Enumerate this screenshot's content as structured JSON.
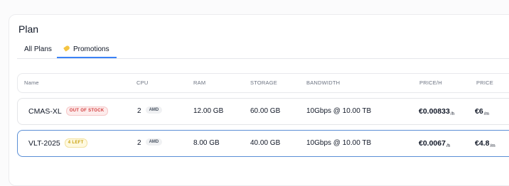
{
  "title": "Plan",
  "tabs": [
    {
      "label": "All Plans",
      "active": false
    },
    {
      "label": "Promotions",
      "active": true,
      "icon": "tag-icon"
    }
  ],
  "columns": {
    "name": "Name",
    "cpu": "CPU",
    "ram": "RAM",
    "storage": "STORAGE",
    "bandwidth": "BANDWIDTH",
    "price_h": "PRICE/H",
    "price": "PRICE"
  },
  "rows": [
    {
      "name": "CMAS-XL",
      "badge": "OUT OF STOCK",
      "cpu": "2",
      "cpu_tag": "AMD",
      "ram": "12.00 GB",
      "storage": "60.00 GB",
      "bandwidth": "10Gbps @ 10.00 TB",
      "price_h": "€0.00833",
      "price_h_unit": "/h",
      "price": "€6",
      "price_unit": "/m"
    },
    {
      "name": "VLT-2025",
      "badge": "4 LEFT",
      "cpu": "2",
      "cpu_tag": "AMD",
      "ram": "8.00 GB",
      "storage": "40.00 GB",
      "bandwidth": "10Gbps @ 10.00 TB",
      "price_h": "€0.0067",
      "price_h_unit": "/h",
      "price": "€4.8",
      "price_unit": "/m",
      "selected": true
    }
  ],
  "colors": {
    "accent": "#3b82f6",
    "selected_border": "#5b8fd6",
    "out_of_stock": "#d23b3b",
    "few_left": "#c9a10e"
  }
}
